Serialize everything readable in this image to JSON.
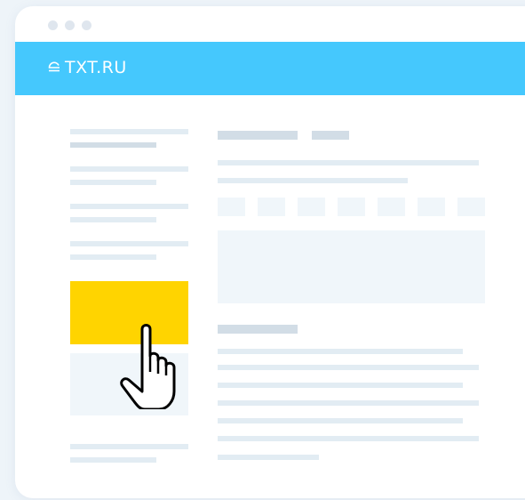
{
  "header": {
    "logo_text": "TXT.RU",
    "logo_icon": "etxt-e-icon",
    "color": "#45c8fd"
  },
  "cta": {
    "color": "#ffd400"
  },
  "cursor": {
    "icon": "hand-pointer-icon"
  },
  "window_controls": [
    "window-dot-1",
    "window-dot-2",
    "window-dot-3"
  ]
}
